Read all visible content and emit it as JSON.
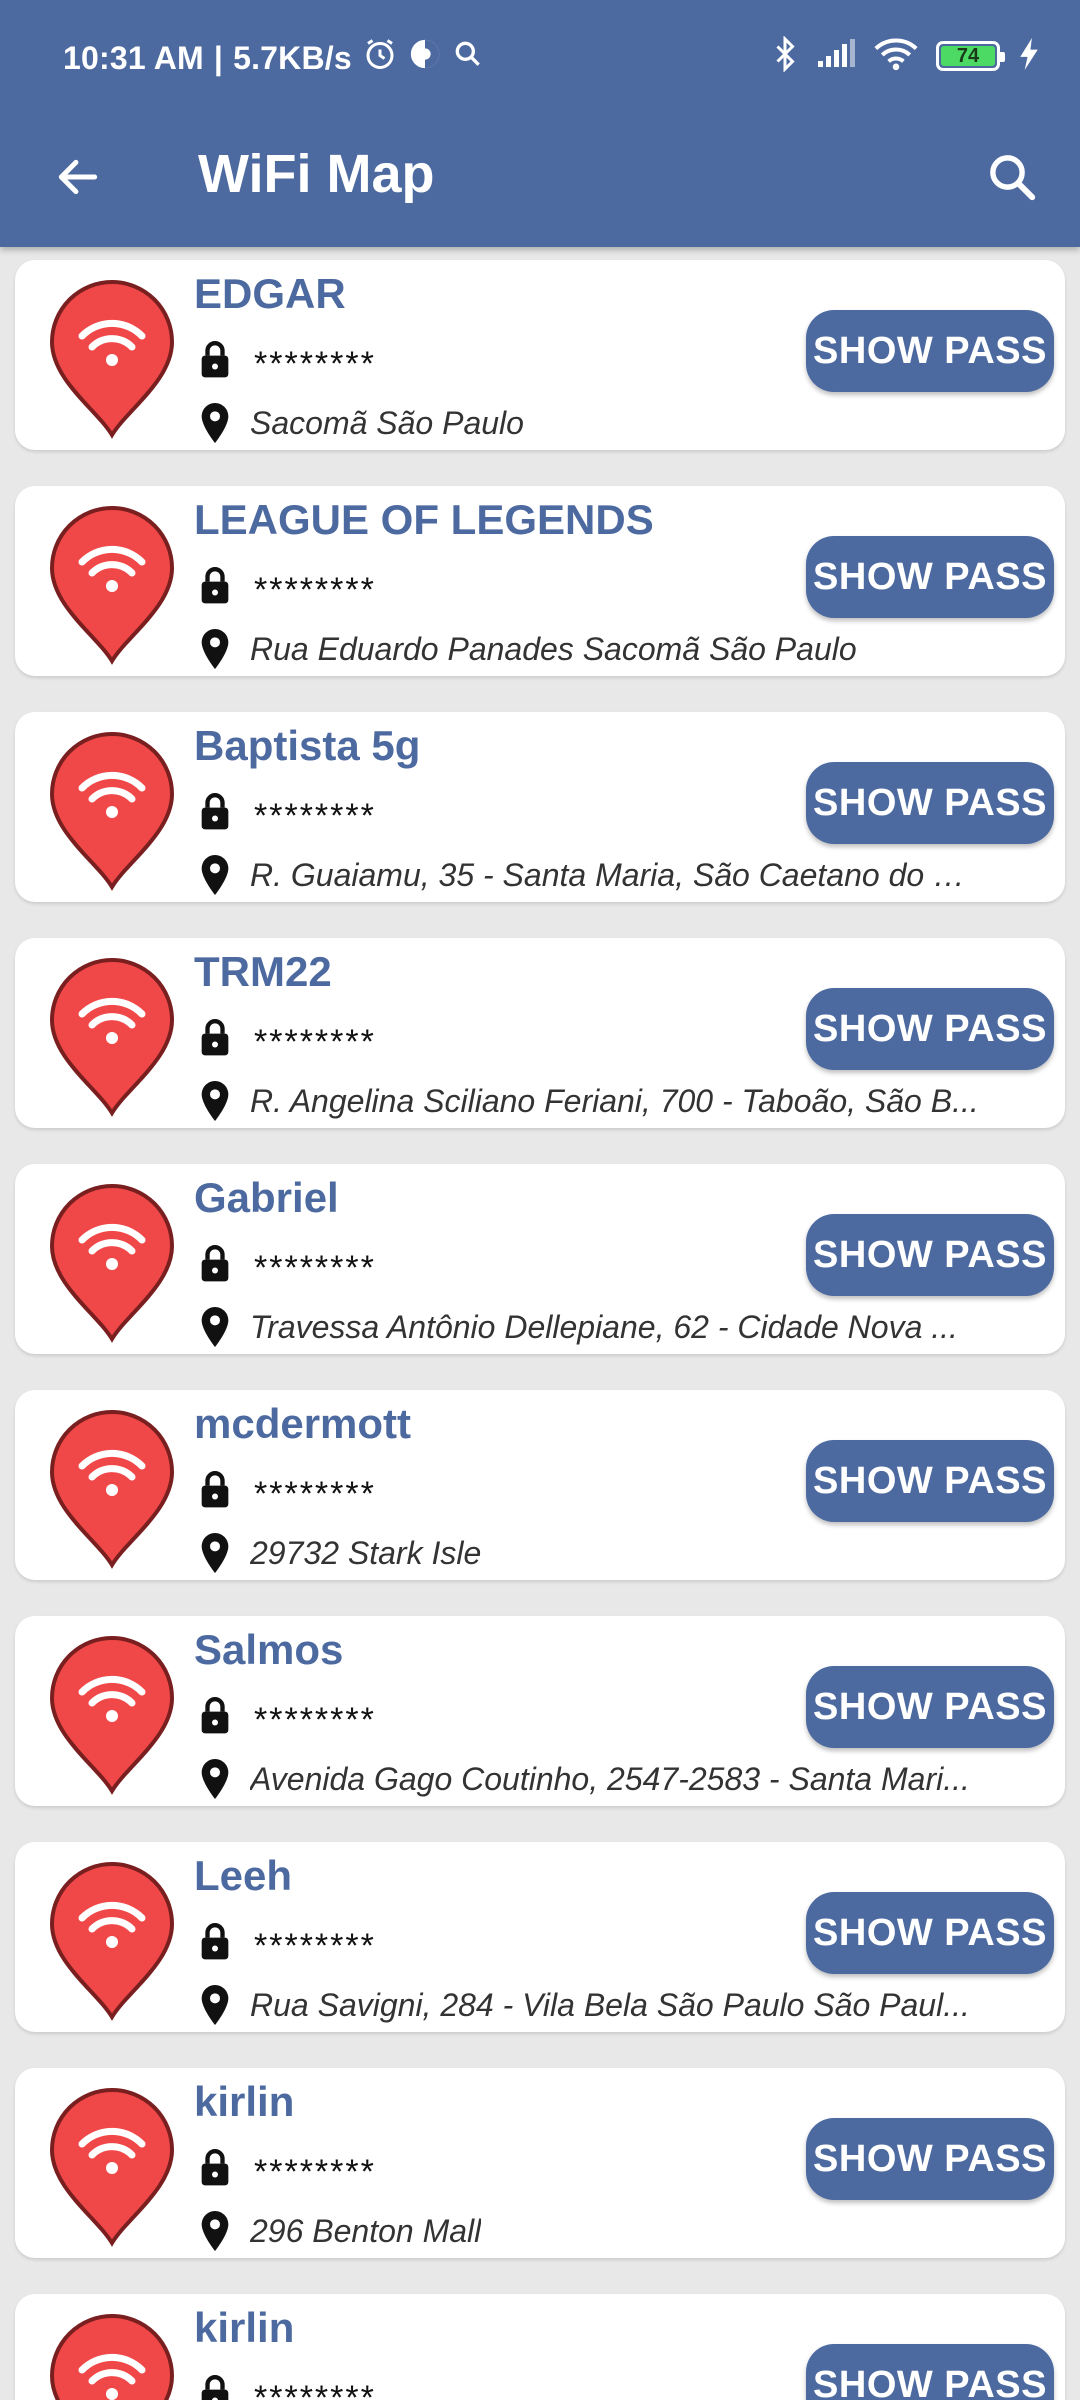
{
  "status": {
    "time": "10:31 AM",
    "separator": "|",
    "speed": "5.7KB/s",
    "battery": "74"
  },
  "appbar": {
    "title": "WiFi Map",
    "back_icon": "arrow-left-icon",
    "search_icon": "search-icon"
  },
  "colors": {
    "primary": "#4d6aa0",
    "pin": "#f04848",
    "pin_border": "#7a1f1f"
  },
  "button_label": "SHOW PASS",
  "networks": [
    {
      "name": "EDGAR",
      "password": "********",
      "location": " Sacomã São Paulo"
    },
    {
      "name": "LEAGUE OF LEGENDS",
      "password": "********",
      "location": "Rua Eduardo Panades Sacomã São Paulo"
    },
    {
      "name": "Baptista 5g",
      "password": "********",
      "location": "R. Guaiamu, 35 - Santa Maria, São Caetano do S..."
    },
    {
      "name": "TRM22",
      "password": "********",
      "location": "R. Angelina Sciliano Feriani, 700 - Taboão, São B..."
    },
    {
      "name": "Gabriel",
      "password": "********",
      "location": "Travessa Antônio Dellepiane, 62 - Cidade Nova ..."
    },
    {
      "name": "mcdermott",
      "password": "********",
      "location": "29732 Stark Isle"
    },
    {
      "name": "Salmos",
      "password": "********",
      "location": "Avenida Gago Coutinho, 2547-2583 - Santa Mari..."
    },
    {
      "name": "Leeh",
      "password": "********",
      "location": "Rua Savigni, 284 - Vila Bela São Paulo São Paul..."
    },
    {
      "name": "kirlin",
      "password": "********",
      "location": "296 Benton Mall"
    },
    {
      "name": "kirlin",
      "password": "********",
      "location": ""
    }
  ]
}
